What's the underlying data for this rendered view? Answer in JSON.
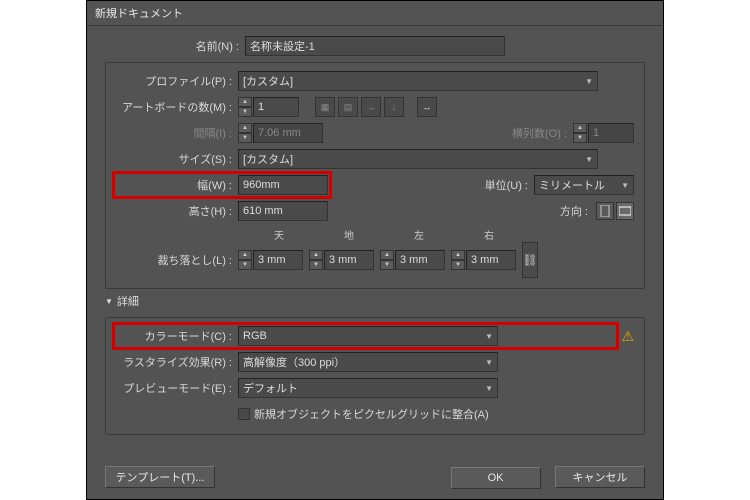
{
  "title": "新規ドキュメント",
  "labels": {
    "name": "名前(N) :",
    "profile": "プロファイル(P) :",
    "artboards": "アートボードの数(M) :",
    "spacing": "間隔(I) :",
    "columns": "横列数(O) :",
    "size": "サイズ(S) :",
    "width": "幅(W) :",
    "units": "単位(U) :",
    "height": "高さ(H) :",
    "orientation": "方向 :",
    "bleed": "裁ち落とし(L) :",
    "top": "天",
    "bottom": "地",
    "left": "左",
    "right": "右",
    "details": "詳細",
    "colormode": "カラーモード(C) :",
    "raster": "ラスタライズ効果(R) :",
    "preview": "プレビューモード(E) :",
    "pixelgrid": "新規オブジェクトをピクセルグリッドに整合(A)"
  },
  "values": {
    "name": "名称未設定-1",
    "profile": "[カスタム]",
    "artboards": "1",
    "spacing": "7.06 mm",
    "columns": "1",
    "size": "[カスタム]",
    "width": "960mm",
    "units": "ミリメートル",
    "height": "610 mm",
    "bleed_top": "3 mm",
    "bleed_bottom": "3 mm",
    "bleed_left": "3 mm",
    "bleed_right": "3 mm",
    "colormode": "RGB",
    "raster": "高解像度（300 ppi）",
    "preview": "デフォルト"
  },
  "buttons": {
    "template": "テンプレート(T)...",
    "ok": "OK",
    "cancel": "キャンセル"
  }
}
